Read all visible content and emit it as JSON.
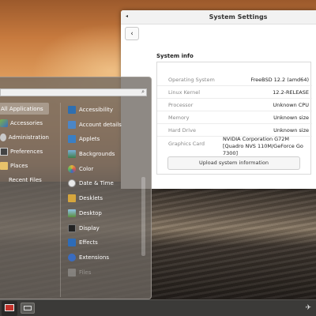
{
  "settings": {
    "title": "System Settings",
    "back_glyph": "‹",
    "close_glyph": "◂",
    "section_title": "System info",
    "rows": [
      {
        "key": "Operating System",
        "value": "FreeBSD 12.2 (amd64)"
      },
      {
        "key": "Linux Kernel",
        "value": "12.2-RELEASE"
      },
      {
        "key": "Processor",
        "value": "Unknown CPU"
      },
      {
        "key": "Memory",
        "value": "Unknown size"
      },
      {
        "key": "Hard Drive",
        "value": "Unknown size"
      },
      {
        "key": "Graphics Card",
        "value": "NVIDIA Corporation G72M [Quadro NVS 110M/GeForce Go 7300]"
      }
    ],
    "upload_label": "Upload system information"
  },
  "menu": {
    "search_icon": "search-icon",
    "search_glyph": "⌕",
    "categories": [
      {
        "label": "All Applications",
        "icon": "all-applications-icon",
        "color": "#5a5a5a"
      },
      {
        "label": "Accessories",
        "icon": "accessories-icon",
        "color": "#7ab04a"
      },
      {
        "label": "Administration",
        "icon": "administration-icon",
        "color": "#c9c9c9"
      },
      {
        "label": "Preferences",
        "icon": "preferences-icon",
        "color": "#444444"
      },
      {
        "label": "Places",
        "icon": "folder-icon",
        "color": "#e8c26a"
      },
      {
        "label": "Recent Files",
        "icon": "",
        "color": ""
      }
    ],
    "apps": [
      {
        "label": "Accessibility",
        "icon": "accessibility-icon",
        "color": "#2f6fb0"
      },
      {
        "label": "Account details",
        "icon": "account-details-icon",
        "color": "#4c86c6"
      },
      {
        "label": "Applets",
        "icon": "applets-icon",
        "color": "#3a7fc4"
      },
      {
        "label": "Backgrounds",
        "icon": "backgrounds-icon",
        "color": "#3f7d4a"
      },
      {
        "label": "Color",
        "icon": "color-icon",
        "color": "#e0b33a"
      },
      {
        "label": "Date & Time",
        "icon": "date-time-icon",
        "color": "#e9e9e9"
      },
      {
        "label": "Desklets",
        "icon": "desklets-icon",
        "color": "#d6a63d"
      },
      {
        "label": "Desktop",
        "icon": "desktop-icon",
        "color": "#5a8c3a"
      },
      {
        "label": "Display",
        "icon": "display-icon",
        "color": "#222222"
      },
      {
        "label": "Effects",
        "icon": "effects-icon",
        "color": "#2e6cb8"
      },
      {
        "label": "Extensions",
        "icon": "extensions-icon",
        "color": "#3a6cc0"
      },
      {
        "label": "Files",
        "icon": "files-icon",
        "color": "#9a9a9a"
      }
    ]
  },
  "panel": {
    "tray_glyph": "✈"
  }
}
